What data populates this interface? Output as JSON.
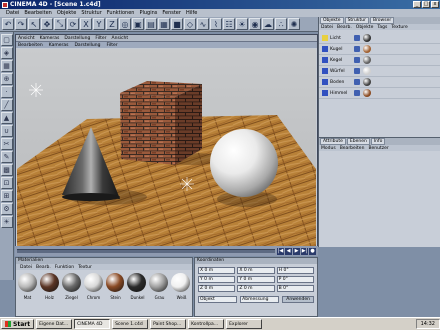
{
  "window": {
    "title": "CINEMA 4D - [Scene 1.c4d]",
    "min": "_",
    "max": "□",
    "close": "x"
  },
  "menu": [
    "Datei",
    "Bearbeiten",
    "Objekte",
    "Struktur",
    "Funktionen",
    "Plugins",
    "Fenster",
    "Hilfe"
  ],
  "toolbar": {
    "icons": [
      "undo-icon",
      "redo-icon",
      "cursor-icon",
      "move-icon",
      "scale-icon",
      "rotate-icon",
      "x-axis-icon",
      "y-axis-icon",
      "z-axis-icon",
      "world-icon",
      "render-view-icon",
      "render-picture-icon",
      "render-settings-icon",
      "cube-icon",
      "nurbs-icon",
      "spline-icon",
      "deformer-icon",
      "scene-icon",
      "light-icon",
      "camera-icon",
      "environment-icon",
      "particle-icon",
      "sun-icon"
    ],
    "glyphs": [
      "↶",
      "↷",
      "↖",
      "✥",
      "⤡",
      "⟳",
      "X",
      "Y",
      "Z",
      "◎",
      "▣",
      "▤",
      "▦",
      "■",
      "◇",
      "∿",
      "⌇",
      "☷",
      "☀",
      "◉",
      "☁",
      "∴",
      "✺"
    ]
  },
  "left_tools": {
    "icons": [
      "model-tool-icon",
      "object-tool-icon",
      "texture-tool-icon",
      "axis-tool-icon",
      "point-tool-icon",
      "edge-tool-icon",
      "polygon-tool-icon",
      "magnet-tool-icon",
      "knife-tool-icon",
      "brush-tool-icon",
      "checker-icon",
      "lock-icon",
      "snap-icon",
      "gear-icon",
      "light-icon"
    ],
    "glyphs": [
      "▢",
      "◈",
      "▦",
      "⊕",
      "·",
      "╱",
      "▲",
      "∪",
      "✂",
      "✎",
      "▩",
      "⊡",
      "⊞",
      "⚙",
      "☀"
    ]
  },
  "viewport": {
    "header": [
      "Ansicht",
      "Kameras",
      "Darstellung",
      "Filter",
      "Ansicht"
    ],
    "menu": [
      "Bearbeiten",
      "Kameras",
      "Darstellung",
      "Filter"
    ]
  },
  "timeline": {
    "buttons": [
      "|◀",
      "◀",
      "▶",
      "▶|",
      "●"
    ]
  },
  "object_manager": {
    "tabs": [
      "Objekte",
      "Struktur",
      "Browser"
    ],
    "menu": [
      "Datei",
      "Bearb.",
      "Objekte",
      "Tags",
      "Texture"
    ],
    "objects": [
      {
        "name": "Licht",
        "icon_color": "#e8d040",
        "tag_color": "#303030"
      },
      {
        "name": "Kugel",
        "icon_color": "#3050c0",
        "tag_color": "#a06030"
      },
      {
        "name": "Kegel",
        "icon_color": "#3050c0",
        "tag_color": "#606060"
      },
      {
        "name": "Würfel",
        "icon_color": "#3050c0",
        "tag_color": "#d0d0d0"
      },
      {
        "name": "Boden",
        "icon_color": "#3050c0",
        "tag_color": "#404040"
      },
      {
        "name": "Himmel",
        "icon_color": "#3050c0",
        "tag_color": "#8a4a20"
      }
    ]
  },
  "attribute_manager": {
    "tabs": [
      "Attribute",
      "Ebenen",
      "Info"
    ],
    "menu": [
      "Modus",
      "Bearbeiten",
      "Benutzer"
    ]
  },
  "material_manager": {
    "tabs": [
      "Materialien"
    ],
    "menu": [
      "Datei",
      "Bearb.",
      "Funktion",
      "Textur"
    ],
    "materials": [
      {
        "name": "Mat",
        "color": "#b8b8b8"
      },
      {
        "name": "Holz",
        "color": "#5a3424"
      },
      {
        "name": "Ziegel",
        "color": "#6a6a6a"
      },
      {
        "name": "Chrom",
        "color": "#d8d8d8"
      },
      {
        "name": "Stein",
        "color": "#8a4a24"
      },
      {
        "name": "Dunkel",
        "color": "#2a2a2a"
      },
      {
        "name": "Grau",
        "color": "#a0a0a0"
      },
      {
        "name": "Weiß",
        "color": "#f0f0f0"
      }
    ]
  },
  "coordinates": {
    "tabs": [
      "Koordinaten"
    ],
    "fields": [
      "X 0 m",
      "X 0 m",
      "H 0°",
      "Y 0 m",
      "Y 0 m",
      "P 0°",
      "Z 0 m",
      "Z 0 m",
      "B 0°"
    ],
    "mode": "Objekt",
    "size_mode": "Abmessung",
    "apply": "Anwenden"
  },
  "taskbar": {
    "start": "Start",
    "tasks": [
      "Eigene Dat...",
      "CINEMA 4D",
      "Scene 1.c4d",
      "Paint Shop...",
      "Kontrollpa...",
      "Explorer"
    ],
    "time": "14:32"
  }
}
